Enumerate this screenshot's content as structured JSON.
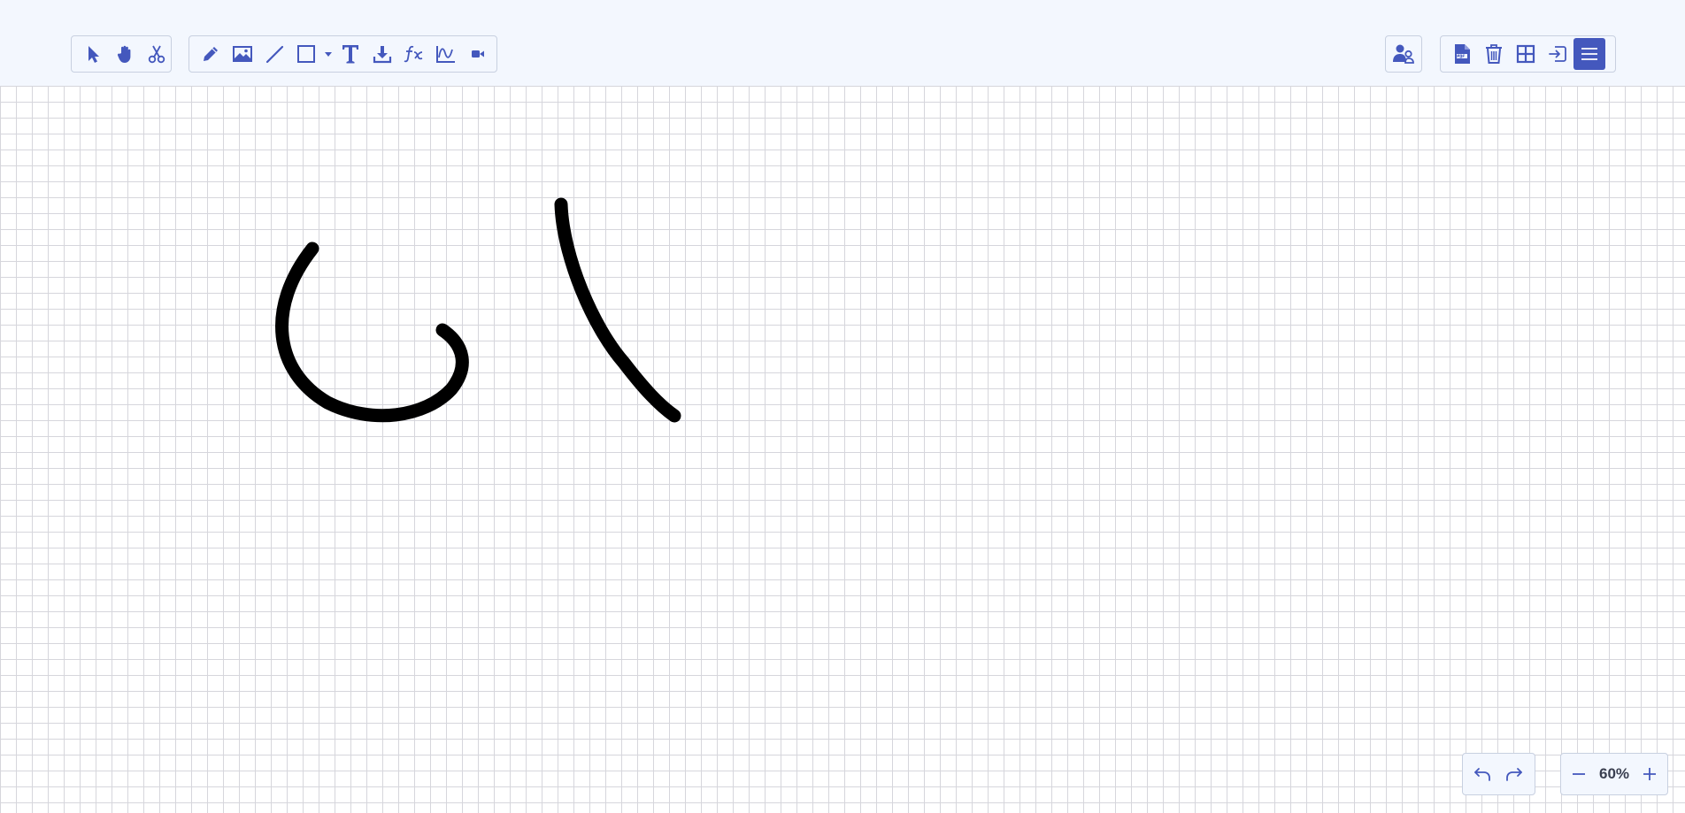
{
  "toolbar": {
    "left_group": [
      {
        "id": "select",
        "icon": "cursor-arrow-icon"
      },
      {
        "id": "pan",
        "icon": "hand-icon"
      },
      {
        "id": "cut",
        "icon": "scissors-icon"
      }
    ],
    "draw_group": [
      {
        "id": "pen",
        "icon": "pencil-icon"
      },
      {
        "id": "image",
        "icon": "image-icon"
      },
      {
        "id": "line",
        "icon": "line-icon"
      },
      {
        "id": "shape",
        "icon": "rectangle-icon"
      },
      {
        "id": "shape-dropdown",
        "icon": "caret-down-icon"
      },
      {
        "id": "text",
        "icon": "text-icon"
      },
      {
        "id": "download",
        "icon": "download-icon"
      },
      {
        "id": "formula",
        "icon": "fx-icon"
      },
      {
        "id": "graph",
        "icon": "function-graph-icon"
      },
      {
        "id": "video",
        "icon": "video-camera-icon"
      }
    ],
    "right_single": [
      {
        "id": "participants",
        "icon": "users-icon"
      }
    ],
    "right_group": [
      {
        "id": "pdf",
        "icon": "pdf-file-icon"
      },
      {
        "id": "clear",
        "icon": "trash-icon"
      },
      {
        "id": "grid",
        "icon": "grid-icon"
      },
      {
        "id": "exit",
        "icon": "sign-in-icon"
      },
      {
        "id": "menu",
        "icon": "hamburger-menu-icon",
        "active": true
      }
    ]
  },
  "history": {
    "undo_icon": "undo-icon",
    "redo_icon": "redo-icon"
  },
  "zoom": {
    "level": "60%",
    "zoom_out_icon": "minus-icon",
    "zoom_in_icon": "plus-icon"
  },
  "colors": {
    "accent": "#4458bd",
    "toolbar_bg": "#f3f7fe",
    "grid_line": "#d6d6dc",
    "ink": "#000000"
  }
}
